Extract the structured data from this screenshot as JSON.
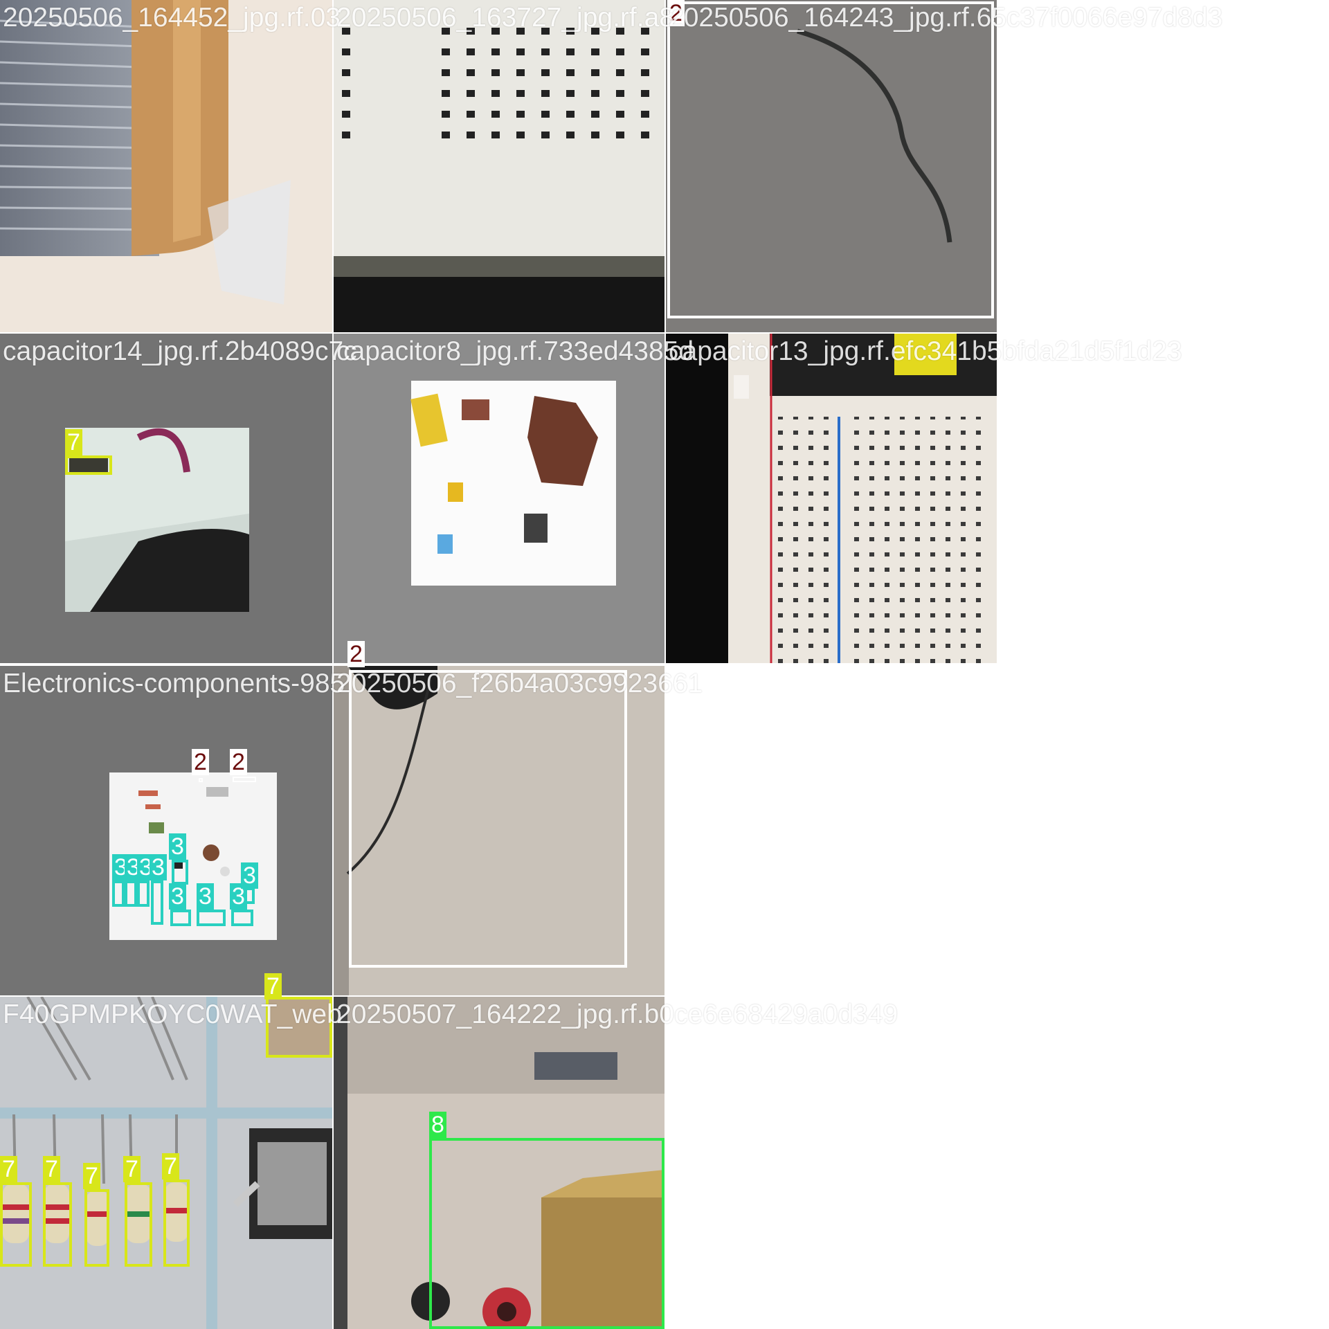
{
  "grid": {
    "tiles": [
      {
        "caption": "20250506_164452_jpg.rf.03",
        "detections": []
      },
      {
        "caption": "20250506_163727_jpg.rf.a8",
        "detections": []
      },
      {
        "caption": "20250506_164243_jpg.rf.65c37f0066e97d8d3",
        "detections": [
          {
            "label": "2",
            "color": "#ffffff",
            "text_color": "#6b0d0d"
          }
        ]
      },
      {
        "caption": "capacitor14_jpg.rf.2b4089c7c",
        "detections": [
          {
            "label": "7",
            "color": "#d8e61a",
            "text_color": "#ffffff"
          }
        ]
      },
      {
        "caption": "capacitor8_jpg.rf.733ed4385d",
        "detections": []
      },
      {
        "caption": "capacitor13_jpg.rf.efc341b5bfda21d5f1d23",
        "detections": []
      },
      {
        "caption": "Electronics-components-985",
        "detections": [
          {
            "label": "2",
            "color": "#ffffff",
            "text_color": "#6b0d0d"
          },
          {
            "label": "2",
            "color": "#ffffff",
            "text_color": "#6b0d0d"
          },
          {
            "label": "3",
            "color": "#29d0c0",
            "text_color": "#ffffff"
          },
          {
            "label": "3",
            "color": "#29d0c0",
            "text_color": "#ffffff"
          },
          {
            "label": "3",
            "color": "#29d0c0",
            "text_color": "#ffffff"
          },
          {
            "label": "3",
            "color": "#29d0c0",
            "text_color": "#ffffff"
          },
          {
            "label": "3",
            "color": "#29d0c0",
            "text_color": "#ffffff"
          },
          {
            "label": "3",
            "color": "#29d0c0",
            "text_color": "#ffffff"
          },
          {
            "label": "3",
            "color": "#29d0c0",
            "text_color": "#ffffff"
          },
          {
            "label": "3",
            "color": "#29d0c0",
            "text_color": "#ffffff"
          },
          {
            "label": "3",
            "color": "#29d0c0",
            "text_color": "#ffffff"
          }
        ]
      },
      {
        "caption": "20250506_f26b4a03c9923661",
        "detections": [
          {
            "label": "2",
            "color": "#ffffff",
            "text_color": "#6b0d0d"
          }
        ]
      },
      {
        "caption": "F40GPMPKOYC0WAT_web",
        "detections": [
          {
            "label": "7",
            "color": "#d8e61a",
            "text_color": "#ffffff"
          },
          {
            "label": "7",
            "color": "#d8e61a",
            "text_color": "#ffffff"
          },
          {
            "label": "7",
            "color": "#d8e61a",
            "text_color": "#ffffff"
          },
          {
            "label": "7",
            "color": "#d8e61a",
            "text_color": "#ffffff"
          },
          {
            "label": "7",
            "color": "#d8e61a",
            "text_color": "#ffffff"
          },
          {
            "label": "7",
            "color": "#d8e61a",
            "text_color": "#ffffff"
          }
        ]
      },
      {
        "caption": "20250507_164222_jpg.rf.b0ce6e68429a0d349",
        "detections": [
          {
            "label": "8",
            "color": "#2ee84a",
            "text_color": "#ffffff"
          }
        ]
      }
    ]
  }
}
